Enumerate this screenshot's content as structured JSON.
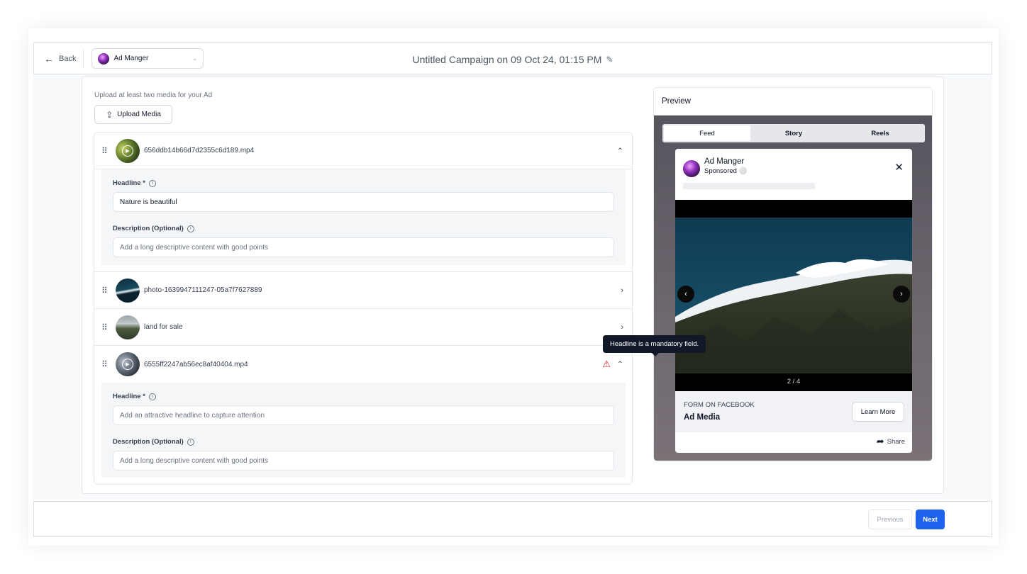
{
  "header": {
    "back_label": "Back",
    "account_name": "Ad Manger",
    "campaign_title": "Untitled Campaign on 09 Oct 24, 01:15 PM"
  },
  "upload": {
    "hint": "Upload at least two media for your Ad",
    "button_label": "Upload Media"
  },
  "media_items": [
    {
      "filename": "656ddb14b66d7d2355c6d189.mp4",
      "expanded": true,
      "headline_label": "Headline *",
      "headline_value": "Nature is beautiful",
      "description_label": "Description (Optional)",
      "description_placeholder": "Add a long descriptive content with good points"
    },
    {
      "filename": "photo-1639947111247-05a7f7627889",
      "expanded": false
    },
    {
      "filename": "land for sale",
      "expanded": false
    },
    {
      "filename": "6555ff2247ab56ec8af40404.mp4",
      "expanded": true,
      "has_error": true,
      "headline_label": "Headline *",
      "headline_placeholder": "Add an attractive headline to capture attention",
      "description_label": "Description (Optional)",
      "description_placeholder": "Add a long descriptive content with good points"
    }
  ],
  "tooltip": "Headline is a mandatory field.",
  "preview": {
    "title": "Preview",
    "tabs": [
      "Feed",
      "Story",
      "Reels"
    ],
    "active_tab": "Feed",
    "ad": {
      "account_name": "Ad Manger",
      "sponsored": "Sponsored",
      "counter": "2 / 4",
      "form_label": "FORM ON FACEBOOK",
      "media_label": "Ad Media",
      "cta_label": "Learn More",
      "share_label": "Share"
    }
  },
  "footer": {
    "previous_label": "Previous",
    "next_label": "Next"
  },
  "colors": {
    "primary": "#1d63ed",
    "error": "#dc2626",
    "tooltip_bg": "#111827"
  }
}
